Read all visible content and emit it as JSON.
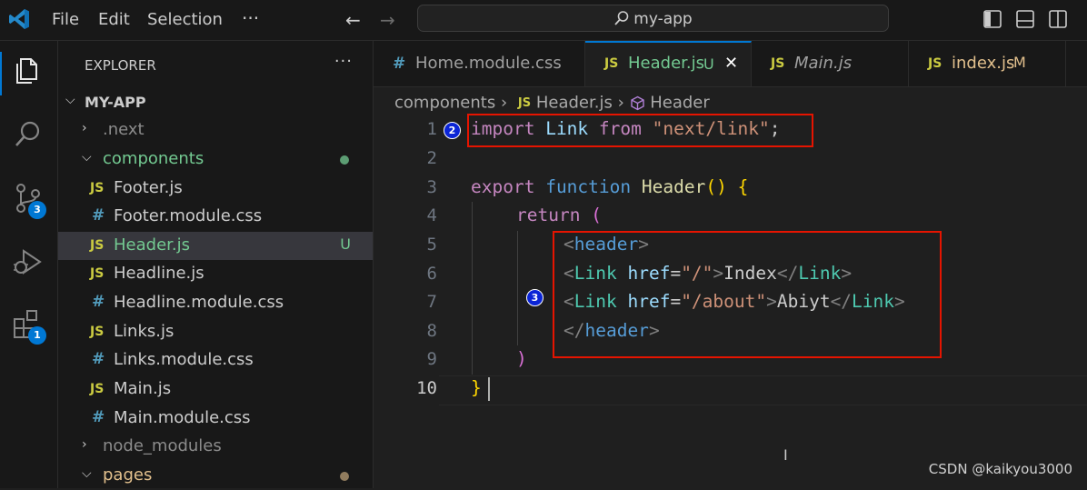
{
  "titlebar": {
    "menu": [
      "File",
      "Edit",
      "Selection"
    ],
    "more": "···",
    "back_arrow": "←",
    "forward_arrow": "→",
    "command_center": "my-app"
  },
  "activitybar": {
    "source_control_badge": "3",
    "extensions_badge": "1"
  },
  "explorer": {
    "title": "EXPLORER",
    "more": "···",
    "root": "MY-APP",
    "items": [
      {
        "label": ".next",
        "kind": "folder",
        "expanded": false
      },
      {
        "label": "components",
        "kind": "folder",
        "expanded": true
      },
      {
        "label": "Footer.js",
        "kind": "js",
        "icon": "JS"
      },
      {
        "label": "Footer.module.css",
        "kind": "css",
        "icon": "#"
      },
      {
        "label": "Header.js",
        "kind": "js",
        "icon": "JS",
        "git": "U",
        "selected": true
      },
      {
        "label": "Headline.js",
        "kind": "js",
        "icon": "JS"
      },
      {
        "label": "Headline.module.css",
        "kind": "css",
        "icon": "#"
      },
      {
        "label": "Links.js",
        "kind": "js",
        "icon": "JS"
      },
      {
        "label": "Links.module.css",
        "kind": "css",
        "icon": "#"
      },
      {
        "label": "Main.js",
        "kind": "js",
        "icon": "JS"
      },
      {
        "label": "Main.module.css",
        "kind": "css",
        "icon": "#"
      },
      {
        "label": "node_modules",
        "kind": "folder",
        "expanded": false
      },
      {
        "label": "pages",
        "kind": "folder",
        "expanded": true
      }
    ]
  },
  "tabs": [
    {
      "label": "Home.module.css",
      "icon": "#"
    },
    {
      "label": "Header.js",
      "icon": "JS",
      "status": "U",
      "close": "✕",
      "active": true
    },
    {
      "label": "Main.js",
      "icon": "JS"
    },
    {
      "label": "index.js",
      "icon": "JS",
      "status": "M"
    }
  ],
  "breadcrumb": {
    "folder": "components",
    "sep": "›",
    "file_icon": "JS",
    "file": "Header.js",
    "symbol": "Header"
  },
  "editor": {
    "line_numbers": [
      "1",
      "2",
      "3",
      "4",
      "5",
      "6",
      "7",
      "8",
      "9",
      "10"
    ],
    "current_line": "10",
    "lines": {
      "l1": {
        "import": "import",
        "link": "Link",
        "from": "from",
        "str": "\"next/link\"",
        "semi": ";"
      },
      "l3": {
        "export": "export",
        "function": "function",
        "name": "Header",
        "parens": "()",
        "brace": "{"
      },
      "l4": {
        "return": "return",
        "paren": "("
      },
      "l5": {
        "open": "<",
        "tag": "header",
        "close": ">"
      },
      "l6": {
        "open": "<",
        "comp": "Link",
        "attr": "href",
        "eq": "=",
        "str": "\"/\"",
        "gt": ">",
        "text": "Index",
        "endopen": "</",
        "endcomp": "Link",
        "endgt": ">"
      },
      "l7": {
        "open": "<",
        "comp": "Link",
        "attr": "href",
        "eq": "=",
        "str": "\"/about\"",
        "gt": ">",
        "text": "Abiyt",
        "endopen": "</",
        "endcomp": "Link",
        "endgt": ">"
      },
      "l8": {
        "open": "</",
        "tag": "header",
        "close": ">"
      },
      "l9": {
        "paren": ")"
      },
      "l10": {
        "brace": "}"
      }
    },
    "markers": [
      "2",
      "3"
    ]
  },
  "watermark": "CSDN @kaikyou3000",
  "colors": {
    "accent": "#0078d4",
    "highlight_box": "#e51400",
    "modified_dot": "#73c991"
  }
}
